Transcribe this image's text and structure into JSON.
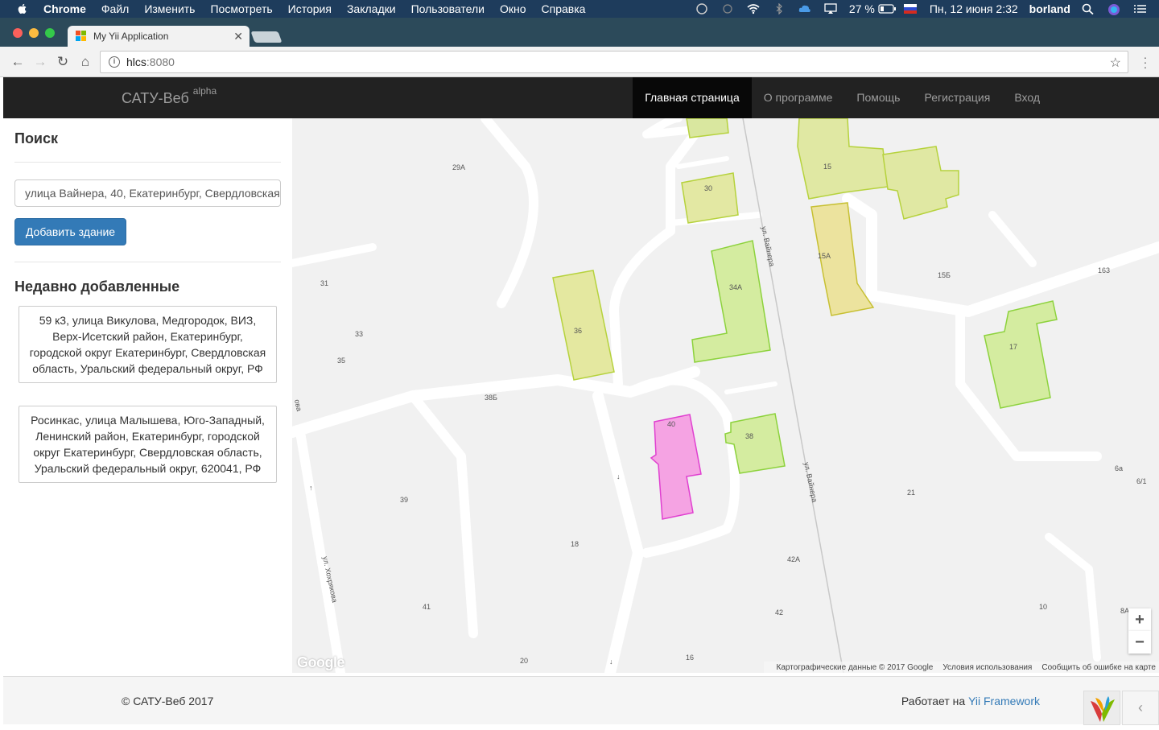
{
  "macos": {
    "app_name": "Chrome",
    "menus": [
      "Файл",
      "Изменить",
      "Посмотреть",
      "История",
      "Закладки",
      "Пользователи",
      "Окно",
      "Справка"
    ],
    "battery": "27 %",
    "datetime": "Пн, 12 июня  2:32",
    "user": "borland"
  },
  "browser": {
    "tab_title": "My Yii Application",
    "url_host": "hlcs",
    "url_port": ":8080"
  },
  "navbar": {
    "brand": "САТУ-Веб",
    "brand_sup": "alpha",
    "links": [
      "Главная страница",
      "О программе",
      "Помощь",
      "Регистрация",
      "Вход"
    ]
  },
  "sidebar": {
    "search_title": "Поиск",
    "search_value": "улица Вайнера, 40, Екатеринбург, Свердловская область, Россия",
    "add_button": "Добавить здание",
    "recent_title": "Недавно добавленные",
    "recent": [
      "59 к3, улица Викулова, Медгородок, ВИЗ, Верх-Исетский район, Екатеринбург, городской округ Екатеринбург, Свердловская область, Уральский федеральный округ, РФ",
      "Росинкас, улица Малышева, Юго-Западный, Ленинский район, Екатеринбург, городской округ Екатеринбург, Свердловская область, Уральский федеральный округ, 620041, РФ"
    ]
  },
  "map": {
    "labels": [
      "29А",
      "30",
      "15",
      "15А",
      "15Б",
      "163",
      "31",
      "34А",
      "36",
      "33",
      "35",
      "17",
      "38Б",
      "40",
      "38",
      "6а",
      "6/1",
      "21",
      "39",
      "18",
      "42А",
      "41",
      "42",
      "10",
      "8А",
      "20",
      "16"
    ],
    "street_labels": [
      "ул. Вайнера",
      "ул. Вайнера",
      "ул. Хохрякова",
      "ова"
    ],
    "zoom_in": "+",
    "zoom_out": "−",
    "google_logo": "Google",
    "attribution": [
      "Картографические данные © 2017 Google",
      "Условия использования",
      "Сообщить об ошибке на карте"
    ],
    "colors": {
      "background": "#f1f1f1",
      "road": "#ffffff",
      "building_green": "#d4eca0",
      "building_yellow": "#e8e79b",
      "building_orange": "#ecdc9c",
      "building_pink": "#f5a3e3"
    }
  },
  "footer": {
    "copyright": "© САТУ-Веб 2017",
    "powered_prefix": "Работает на ",
    "powered_link": "Yii Framework",
    "toggle": "‹"
  }
}
